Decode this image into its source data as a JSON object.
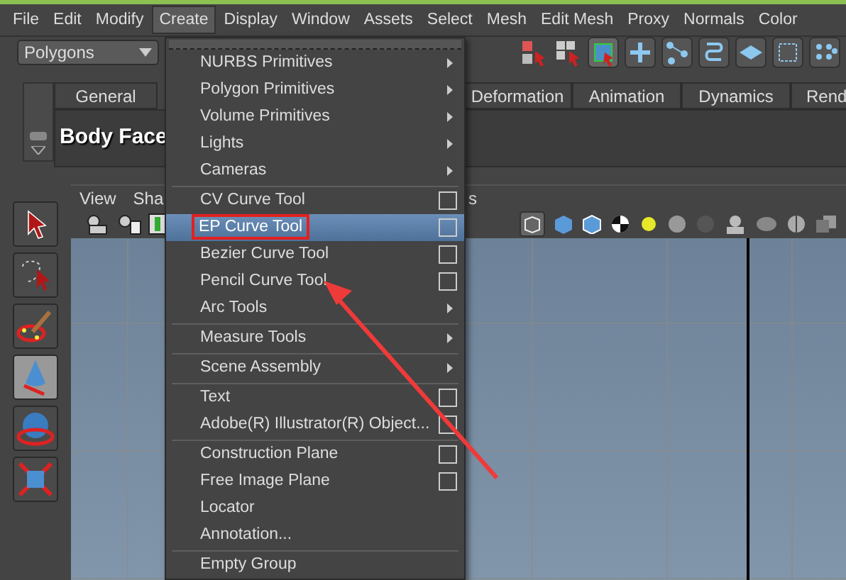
{
  "menubar": [
    {
      "label": "File",
      "selected": false
    },
    {
      "label": "Edit",
      "selected": false
    },
    {
      "label": "Modify",
      "selected": false
    },
    {
      "label": "Create",
      "selected": true
    },
    {
      "label": "Display",
      "selected": false
    },
    {
      "label": "Window",
      "selected": false
    },
    {
      "label": "Assets",
      "selected": false
    },
    {
      "label": "Select",
      "selected": false
    },
    {
      "label": "Mesh",
      "selected": false
    },
    {
      "label": "Edit Mesh",
      "selected": false
    },
    {
      "label": "Proxy",
      "selected": false
    },
    {
      "label": "Normals",
      "selected": false
    },
    {
      "label": "Color",
      "selected": false
    }
  ],
  "mode_dropdown": {
    "value": "Polygons"
  },
  "shelf_tabs": [
    {
      "label": "General",
      "selected": false
    },
    {
      "label": "Deformation",
      "selected": false
    },
    {
      "label": "Animation",
      "selected": false
    },
    {
      "label": "Dynamics",
      "selected": false
    },
    {
      "label": "Rend",
      "selected": false
    }
  ],
  "shelf": {
    "label": "Body Face"
  },
  "panel_menu": [
    "View",
    "Sha",
    "s"
  ],
  "create_menu": {
    "sections": [
      [
        {
          "label": "NURBS Primitives",
          "kind": "submenu",
          "selected": false
        },
        {
          "label": "Polygon Primitives",
          "kind": "submenu",
          "selected": false
        },
        {
          "label": "Volume Primitives",
          "kind": "submenu",
          "selected": false
        },
        {
          "label": "Lights",
          "kind": "submenu",
          "selected": false
        },
        {
          "label": "Cameras",
          "kind": "submenu",
          "selected": false
        }
      ],
      [
        {
          "label": "CV Curve Tool",
          "kind": "option",
          "selected": false
        },
        {
          "label": "EP Curve Tool",
          "kind": "option",
          "selected": true
        },
        {
          "label": "Bezier Curve Tool",
          "kind": "option",
          "selected": false
        },
        {
          "label": "Pencil Curve Tool",
          "kind": "option",
          "selected": false
        },
        {
          "label": "Arc Tools",
          "kind": "submenu",
          "selected": false
        }
      ],
      [
        {
          "label": "Measure Tools",
          "kind": "submenu",
          "selected": false
        }
      ],
      [
        {
          "label": "Scene Assembly",
          "kind": "submenu",
          "selected": false
        }
      ],
      [
        {
          "label": "Text",
          "kind": "option",
          "selected": false
        },
        {
          "label": "Adobe(R) Illustrator(R) Object...",
          "kind": "option",
          "selected": false
        }
      ],
      [
        {
          "label": "Construction Plane",
          "kind": "option",
          "selected": false
        },
        {
          "label": "Free Image Plane",
          "kind": "option",
          "selected": false
        },
        {
          "label": "Locator",
          "kind": "plain",
          "selected": false
        },
        {
          "label": "Annotation...",
          "kind": "plain",
          "selected": false
        }
      ],
      [
        {
          "label": "Empty Group",
          "kind": "plain",
          "selected": false
        }
      ]
    ]
  }
}
